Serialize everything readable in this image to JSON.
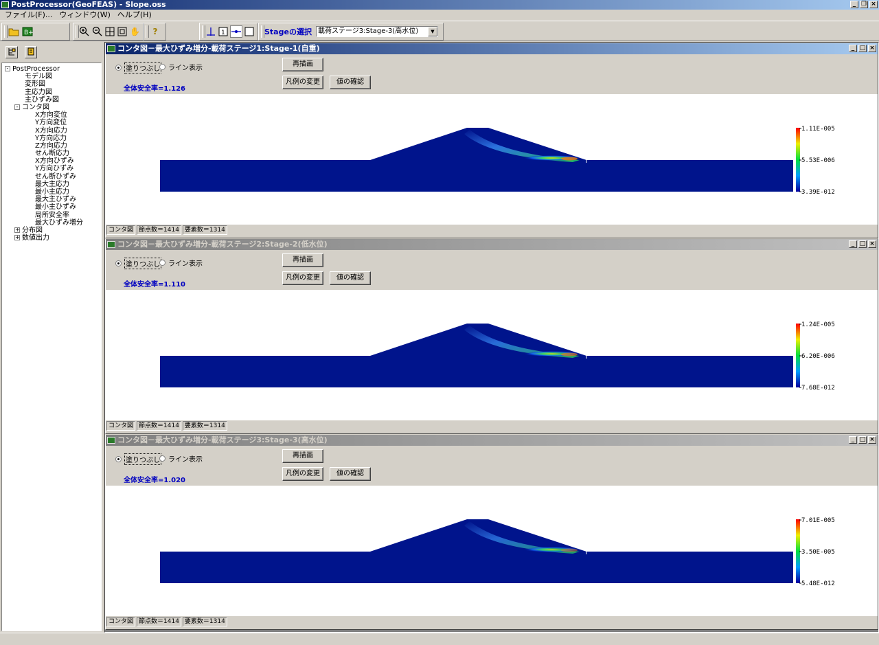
{
  "app": {
    "title": "PostProcessor(GeoFEAS) - Slope.oss"
  },
  "menu": [
    "ファイル(F)...",
    "ウィンドウ(W)",
    "ヘルプ(H)"
  ],
  "toolbar": {
    "stage_label": "Stageの選択",
    "stage_value": "載荷ステージ3:Stage-3(高水位)"
  },
  "tree": {
    "root": "PostProcessor",
    "items": [
      {
        "label": "モデル図",
        "level": 1
      },
      {
        "label": "変形図",
        "level": 1
      },
      {
        "label": "主応力図",
        "level": 1
      },
      {
        "label": "主ひずみ図",
        "level": 1
      },
      {
        "label": "コンタ図",
        "level": 1,
        "expander": "-"
      },
      {
        "label": "X方向変位",
        "level": 2
      },
      {
        "label": "Y方向変位",
        "level": 2
      },
      {
        "label": "X方向応力",
        "level": 2
      },
      {
        "label": "Y方向応力",
        "level": 2
      },
      {
        "label": "Z方向応力",
        "level": 2
      },
      {
        "label": "せん断応力",
        "level": 2
      },
      {
        "label": "X方向ひずみ",
        "level": 2
      },
      {
        "label": "Y方向ひずみ",
        "level": 2
      },
      {
        "label": "せん断ひずみ",
        "level": 2
      },
      {
        "label": "最大主応力",
        "level": 2
      },
      {
        "label": "最小主応力",
        "level": 2
      },
      {
        "label": "最大主ひずみ",
        "level": 2
      },
      {
        "label": "最小主ひずみ",
        "level": 2
      },
      {
        "label": "局所安全率",
        "level": 2
      },
      {
        "label": "最大ひずみ増分",
        "level": 2
      },
      {
        "label": "分布図",
        "level": 1,
        "expander": "+"
      },
      {
        "label": "数値出力",
        "level": 1,
        "expander": "+"
      }
    ]
  },
  "windows": [
    {
      "title": "コンタ図－最大ひずみ増分-載荷ステージ1:Stage-1(自重)",
      "active": true,
      "radio_fill": "塗りつぶし",
      "radio_line": "ライン表示",
      "btn_redraw": "再描画",
      "btn_legend": "凡例の変更",
      "btn_values": "値の確認",
      "safety": "全体安全率=1.126",
      "legend": [
        "1.11E-005",
        "5.53E-006",
        "3.39E-012"
      ],
      "intensity": 0.75,
      "status": [
        "コンタ図",
        "節点数＝1414",
        "要素数＝1314"
      ]
    },
    {
      "title": "コンタ図－最大ひずみ増分-載荷ステージ2:Stage-2(低水位)",
      "active": false,
      "radio_fill": "塗りつぶし",
      "radio_line": "ライン表示",
      "btn_redraw": "再描画",
      "btn_legend": "凡例の変更",
      "btn_values": "値の確認",
      "safety": "全体安全率=1.110",
      "legend": [
        "1.24E-005",
        "6.20E-006",
        "7.68E-012"
      ],
      "intensity": 0.6,
      "status": [
        "コンタ図",
        "節点数＝1414",
        "要素数＝1314"
      ]
    },
    {
      "title": "コンタ図－最大ひずみ増分-載荷ステージ3:Stage-3(高水位)",
      "active": false,
      "radio_fill": "塗りつぶし",
      "radio_line": "ライン表示",
      "btn_redraw": "再描画",
      "btn_legend": "凡例の変更",
      "btn_values": "値の確認",
      "safety": "全体安全率=1.020",
      "legend": [
        "7.01E-005",
        "3.50E-005",
        "5.48E-012"
      ],
      "intensity": 0.45,
      "status": [
        "コンタ図",
        "節点数＝1414",
        "要素数＝1314"
      ]
    }
  ],
  "colors": {
    "model_blue": "#00148c",
    "title_active": "#0a246a",
    "accent_text": "#0000c0"
  }
}
